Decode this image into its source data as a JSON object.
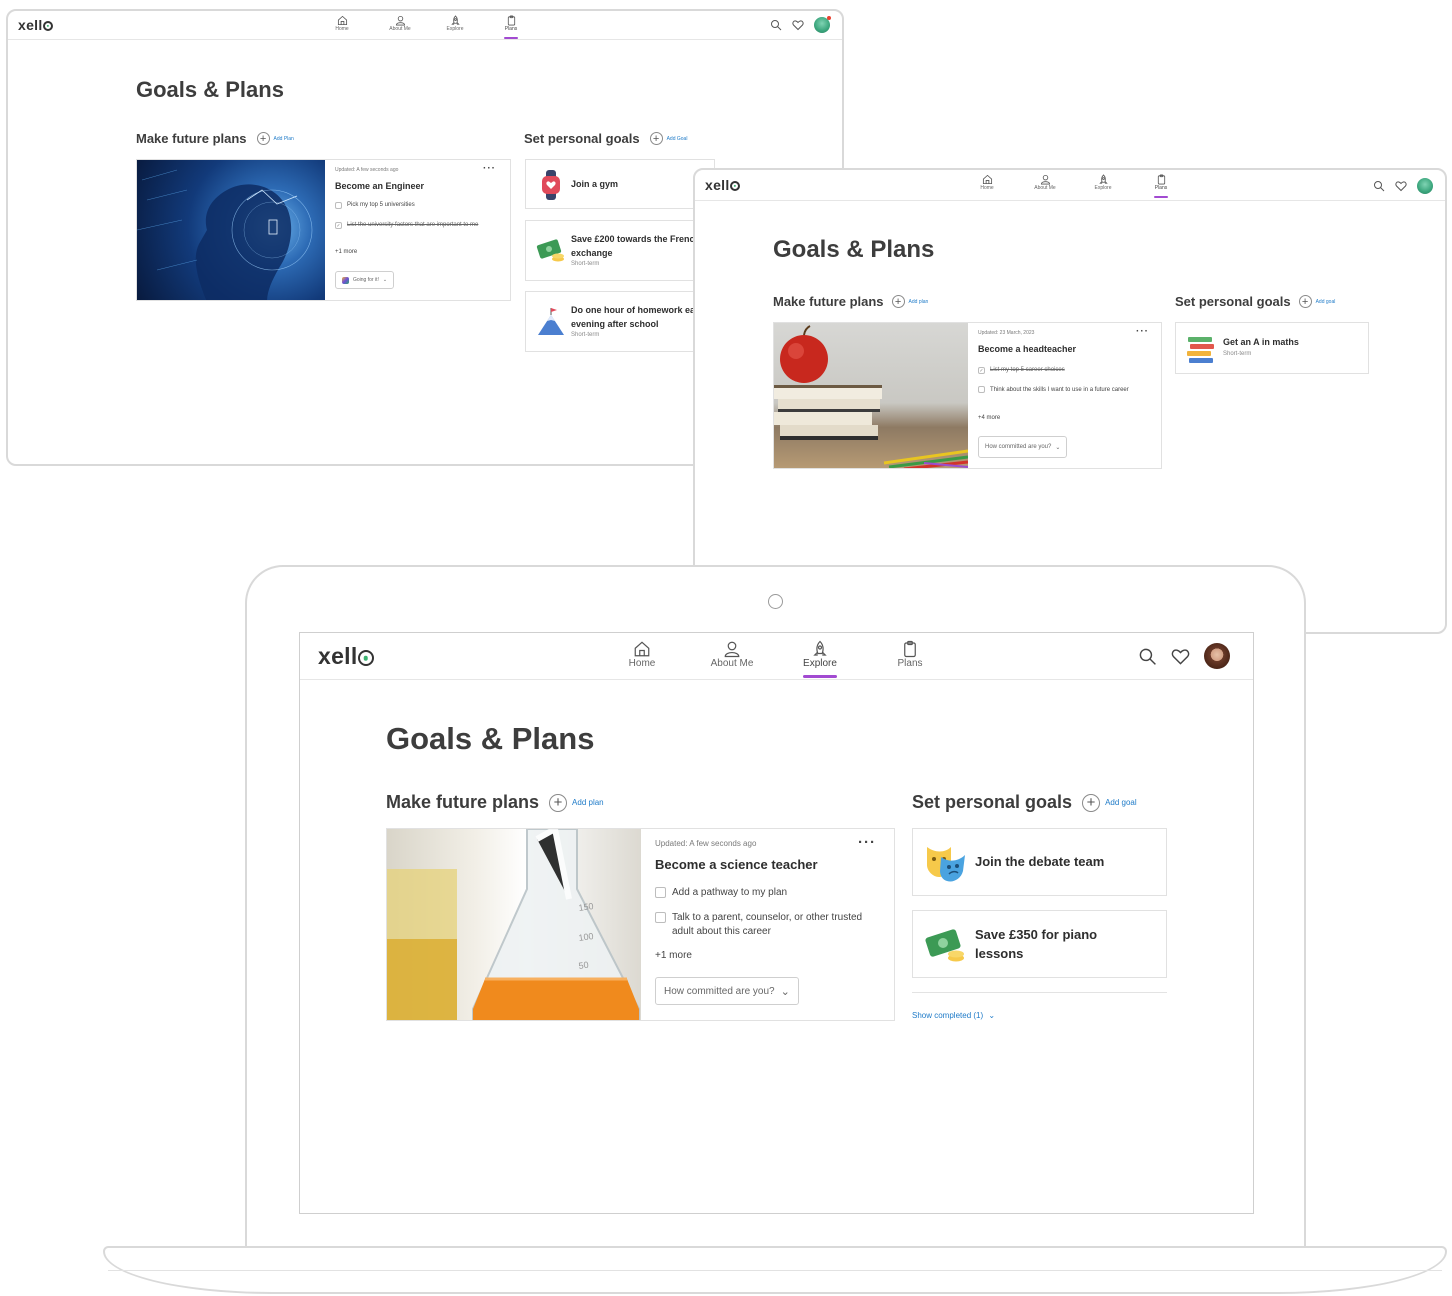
{
  "brand": {
    "logo_text_a": "xell",
    "logo_text_b": "",
    "accent": "#a24ad1",
    "link": "#1f7bc8"
  },
  "nav": {
    "home": "Home",
    "about": "About Me",
    "explore": "Explore",
    "plans": "Plans"
  },
  "page_title": "Goals & Plans",
  "screen1": {
    "plans_title": "Make future plans",
    "add_plan": "Add Plan",
    "goals_title": "Set personal goals",
    "add_goal": "Add Goal",
    "plan": {
      "updated": "Updated: A few seconds ago",
      "title": "Become an Engineer",
      "task1": "Pick my top 5 universities",
      "task2": "List the university factors that are important to me",
      "more": "+1 more",
      "commit": "Going for it!"
    },
    "goals": [
      {
        "title": "Join a gym",
        "sub": ""
      },
      {
        "title": "Save £200 towards the French exchange",
        "sub": "Short-term"
      },
      {
        "title": "Do one hour of homework each evening after school",
        "sub": "Short-term"
      }
    ]
  },
  "screen2": {
    "plans_title": "Make future plans",
    "add_plan": "Add plan",
    "goals_title": "Set personal goals",
    "add_goal": "Add goal",
    "plan": {
      "updated": "Updated: 23 March, 2023",
      "title": "Become a headteacher",
      "task1": "List my top 5 career choices",
      "task2": "Think about the skills I want to use in a future career",
      "more": "+4 more",
      "commit": "How committed are you?"
    },
    "goals": [
      {
        "title": "Get an A in maths",
        "sub": "Short-term"
      }
    ]
  },
  "screen3": {
    "plans_title": "Make future plans",
    "add_plan": "Add plan",
    "goals_title": "Set personal goals",
    "add_goal": "Add goal",
    "plan": {
      "updated": "Updated: A few seconds ago",
      "title": "Become a science teacher",
      "task1": "Add a pathway to my plan",
      "task2": "Talk to a parent, counselor, or other trusted adult about this career",
      "more": "+1 more",
      "commit": "How committed are you?"
    },
    "goals": [
      {
        "title": "Join the debate team"
      },
      {
        "title": "Save £350 for piano lessons"
      }
    ],
    "show_completed": "Show completed (1)"
  }
}
